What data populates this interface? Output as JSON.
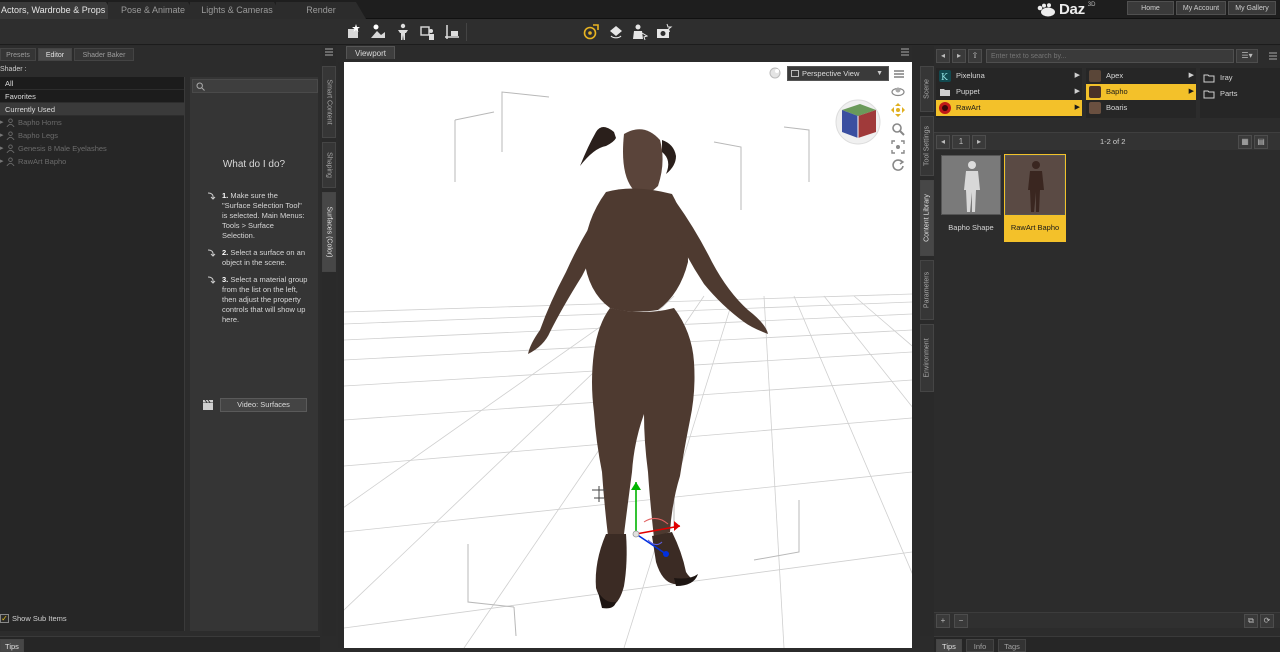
{
  "workspace_tabs": [
    "Actors, Wardrobe & Props",
    "Pose & Animate",
    "Lights & Cameras",
    "Render"
  ],
  "logo": {
    "text": "Daz",
    "sup": "3D"
  },
  "top_buttons": [
    "Home",
    "My Account",
    "My Gallery"
  ],
  "left_panel": {
    "tabs": [
      "Presets",
      "Editor",
      "Shader Baker"
    ],
    "shader_label": "Shader :",
    "filters": [
      "All",
      "Favorites",
      "Currently Used"
    ],
    "materials": [
      "Bapho Horns",
      "Bapho Legs",
      "Genesis 8 Male Eyelashes",
      "RawArt Bapho"
    ],
    "show_sub_items": "Show Sub Items",
    "help": {
      "title": "What do I do?",
      "steps": [
        {
          "num": "1.",
          "text": "Make sure the \"Surface Selection Tool\" is selected. Main Menus: Tools > Surface Selection."
        },
        {
          "num": "2.",
          "text": "Select a surface on an object in the scene."
        },
        {
          "num": "3.",
          "text": "Select a material group from the list on the left, then adjust the property controls that will show up here."
        }
      ],
      "video_button": "Video: Surfaces"
    },
    "side_tabs": [
      "Smart Content",
      "Shaping",
      "Surfaces (Color)"
    ],
    "bottom_tab": "Tips"
  },
  "viewport": {
    "tab": "Viewport",
    "camera": "Perspective View"
  },
  "right_panel": {
    "search_placeholder": "Enter text to search by...",
    "side_tabs": [
      "Scene",
      "Tool Settings",
      "Content Library",
      "Parameters",
      "Environment"
    ],
    "col1": [
      "Pixeluna",
      "Puppet",
      "RawArt"
    ],
    "col2": [
      "Apex",
      "Bapho",
      "Boaris"
    ],
    "col3": [
      "Iray",
      "Parts"
    ],
    "page": "1",
    "page_info": "1-2 of 2",
    "items": [
      "Bapho Shape",
      "RawArt Bapho"
    ],
    "bottom_tabs": [
      "Tips",
      "Info",
      "Tags"
    ]
  },
  "colors": {
    "accent": "#f3c12a",
    "toolbar_icon_active": "#e8b422"
  }
}
